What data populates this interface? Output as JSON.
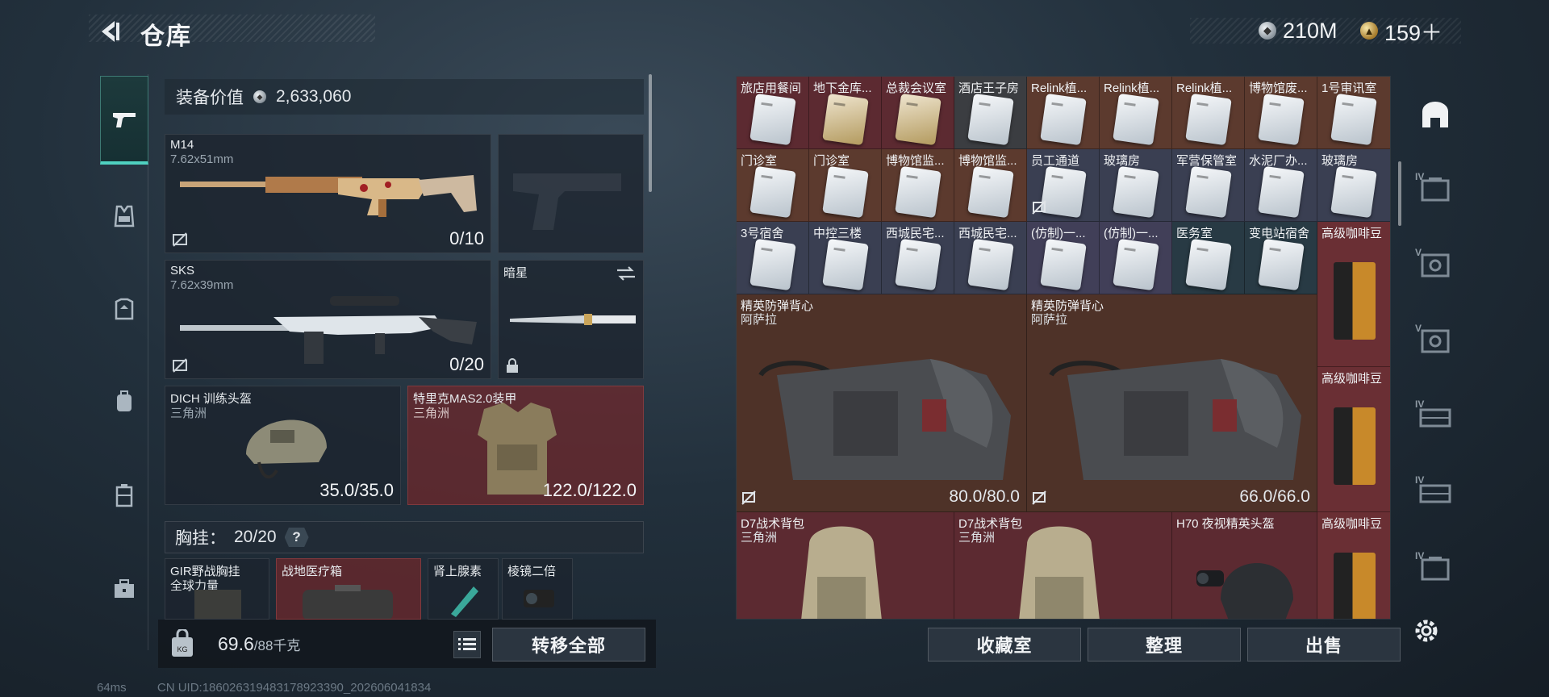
{
  "header": {
    "title": "仓库"
  },
  "currencies": [
    {
      "icon": "silver-coin-icon",
      "value": "210M"
    },
    {
      "icon": "gold-coin-icon",
      "value": "159＋"
    }
  ],
  "left_nav": {
    "items": [
      {
        "name": "weapons",
        "icon": "pistol-icon",
        "active": true
      },
      {
        "name": "vest",
        "icon": "vest-icon"
      },
      {
        "name": "armor",
        "icon": "armor-icon"
      },
      {
        "name": "backpack",
        "icon": "backpack-icon"
      },
      {
        "name": "case",
        "icon": "case-icon"
      },
      {
        "name": "toolbox",
        "icon": "toolbox-icon"
      }
    ]
  },
  "equipment": {
    "value_label": "装备价值",
    "value": "2,633,060",
    "primary": {
      "name": "M14",
      "caliber": "7.62x51mm",
      "ammo": "0/10"
    },
    "secondary": {
      "name": "SKS",
      "caliber": "7.62x39mm",
      "ammo": "0/20"
    },
    "melee": {
      "name": "暗星"
    },
    "helmet": {
      "name": "DICH 训练头盔",
      "faction": "三角洲",
      "durability": "35.0/35.0"
    },
    "armor": {
      "name": "特里克MAS2.0装甲",
      "faction": "三角洲",
      "durability": "122.0/122.0"
    },
    "chest_rig": {
      "label": "胸挂：",
      "capacity": "20/20",
      "help": "?"
    },
    "chest_items": [
      {
        "name": "GIR野战胸挂",
        "sub": "全球力量"
      },
      {
        "name": "战地医疗箱",
        "sub": ""
      },
      {
        "name": "肾上腺素",
        "sub": ""
      },
      {
        "name": "棱镜二倍",
        "sub": ""
      }
    ]
  },
  "bottom_left": {
    "weight": "69.6",
    "weight_max": "/88千克",
    "transfer_all": "转移全部"
  },
  "stash": {
    "row1": [
      "旅店用餐间",
      "地下金库...",
      "总裁会议室",
      "酒店王子房",
      "Relink植...",
      "Relink植...",
      "Relink植...",
      "博物馆废...",
      "1号审讯室"
    ],
    "row2": [
      "门诊室",
      "门诊室",
      "博物馆监...",
      "博物馆监...",
      "员工通道",
      "玻璃房",
      "军营保管室",
      "水泥厂办...",
      "玻璃房"
    ],
    "row3": [
      "3号宿舍",
      "中控三楼",
      "西城民宅...",
      "西城民宅...",
      "(仿制)一...",
      "(仿制)一...",
      "医务室",
      "变电站宿舍",
      "高级咖啡豆"
    ],
    "vest1": {
      "name": "精英防弹背心",
      "faction": "阿萨拉",
      "durability": "80.0/80.0"
    },
    "vest2": {
      "name": "精英防弹背心",
      "faction": "阿萨拉",
      "durability": "66.0/66.0"
    },
    "coffee_label": "高级咖啡豆",
    "bag1": {
      "name": "D7战术背包",
      "faction": "三角洲"
    },
    "bag2": {
      "name": "D7战术背包",
      "faction": "三角洲"
    },
    "helmet": {
      "name": "H70 夜视精英头盔"
    }
  },
  "bottom_right": {
    "collection": "收藏室",
    "organize": "整理",
    "sell": "出售"
  },
  "right_nav": {
    "tiers": [
      "",
      "IV",
      "V",
      "V",
      "IV",
      "IV",
      "IV"
    ]
  },
  "status_bar": {
    "ping": "64ms",
    "uid": "CN UID:18602631948317892339​0_202606041834"
  }
}
